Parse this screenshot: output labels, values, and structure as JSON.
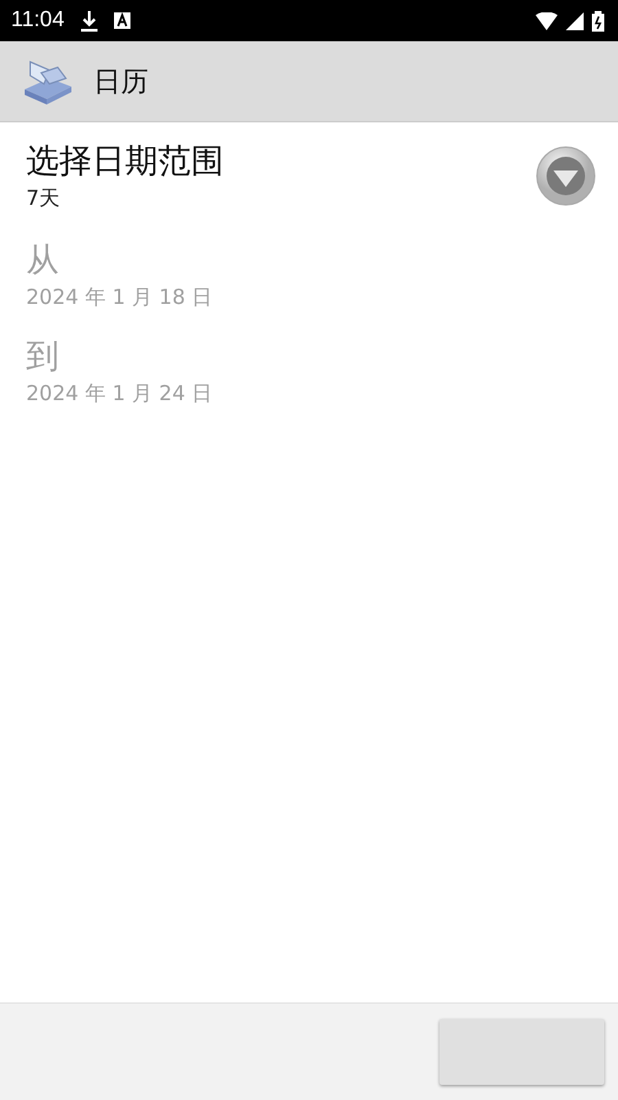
{
  "status_bar": {
    "time": "11:04"
  },
  "action_bar": {
    "title": "日历"
  },
  "range": {
    "title": "选择日期范围",
    "value": "7天"
  },
  "fields": [
    {
      "label": "从",
      "value": "2024 年 1 月 18 日",
      "disabled": true
    },
    {
      "label": "到",
      "value": "2024 年 1 月 24 日",
      "disabled": true
    }
  ]
}
